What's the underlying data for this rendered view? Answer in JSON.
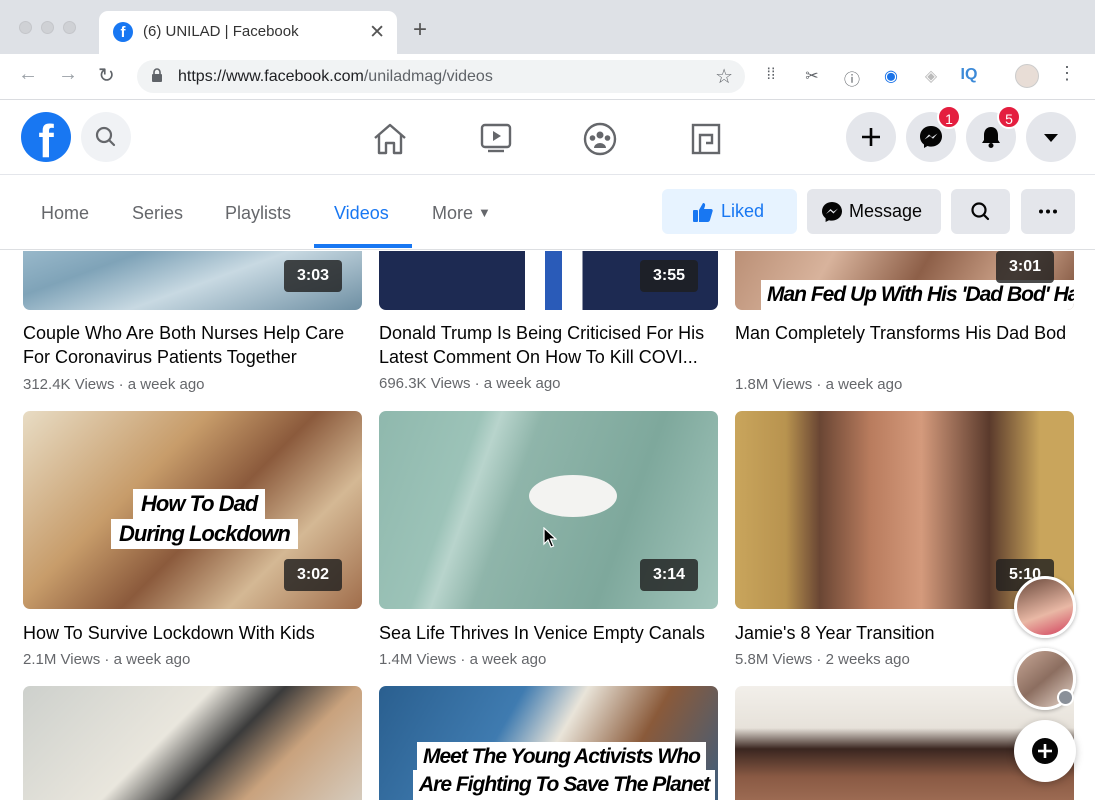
{
  "browser": {
    "tab_title": "(6) UNILAD | Facebook",
    "url_host": "https://www.facebook.com",
    "url_path": "/uniladmag/videos",
    "extension_iq": "IQ"
  },
  "fb": {
    "messenger_badge": "1",
    "notifications_badge": "5"
  },
  "page_nav": {
    "tabs": [
      "Home",
      "Series",
      "Playlists",
      "Videos",
      "More"
    ],
    "liked_label": "Liked",
    "message_label": "Message"
  },
  "videos": [
    {
      "title": "Couple Who Are Both Nurses Help Care For Coronavirus Patients Together",
      "views": "312.4K Views",
      "age": "a week ago",
      "duration": "3:03"
    },
    {
      "title": "Donald Trump Is Being Criticised For His Latest Comment On How To Kill COVI...",
      "views": "696.3K Views",
      "age": "a week ago",
      "duration": "3:55"
    },
    {
      "title": "Man Completely Transforms His Dad Bod",
      "views": "1.8M Views",
      "age": "a week ago",
      "duration": "3:01",
      "caption": "Man Fed Up With His 'Dad Bod' Has"
    },
    {
      "title": "How To Survive Lockdown With Kids",
      "views": "2.1M Views",
      "age": "a week ago",
      "duration": "3:02",
      "caption_line1": "How To Dad",
      "caption_line2": "During Lockdown"
    },
    {
      "title": "Sea Life Thrives In Venice Empty Canals",
      "views": "1.4M Views",
      "age": "a week ago",
      "duration": "3:14"
    },
    {
      "title": "Jamie's 8 Year Transition",
      "views": "5.8M Views",
      "age": "2 weeks ago",
      "duration": "5:10"
    },
    {
      "caption_line1": "Meet The Young Activists Who",
      "caption_line2": "Are Fighting To Save The Planet"
    }
  ],
  "meta_separator": " · ",
  "colors": {
    "brand": "#1877f2",
    "badge": "#e41e3f"
  }
}
